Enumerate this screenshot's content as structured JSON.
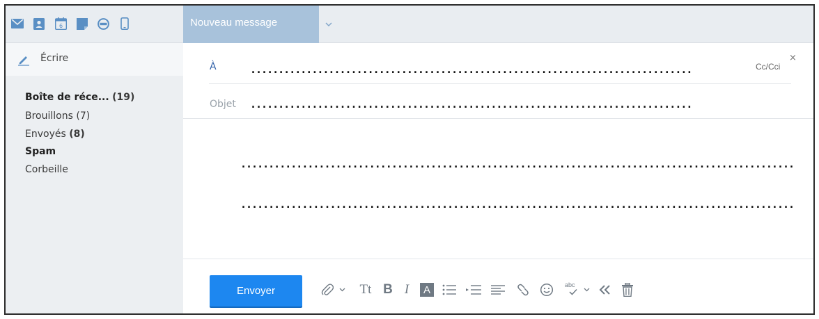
{
  "toolbar": {
    "icons": [
      "mail-icon",
      "contacts-icon",
      "calendar-icon",
      "notes-icon",
      "messenger-icon",
      "mobile-icon"
    ],
    "calendar_day": "6"
  },
  "tab": {
    "label": "Nouveau message"
  },
  "sidebar": {
    "compose_label": "Écrire",
    "folders": [
      {
        "name": "Boîte de réce...",
        "count": "(19)",
        "bold": true
      },
      {
        "name": "Brouillons",
        "count": "(7)",
        "bold": false
      },
      {
        "name": "Envoyés",
        "count": "(8)",
        "bold": false
      },
      {
        "name": "Spam",
        "count": "",
        "bold": true
      },
      {
        "name": "Corbeille",
        "count": "",
        "bold": false
      }
    ]
  },
  "compose": {
    "to_label": "À",
    "to_value": "...............................................................................",
    "cc_label": "Cc/Cci",
    "close_label": "×",
    "subject_label": "Objet",
    "subject_value": "...............................................................................",
    "body_line_1": "...................................................................................................",
    "body_line_2": "..................................................................................................."
  },
  "footer": {
    "send_label": "Envoyer",
    "tools": [
      "attach-icon",
      "attach-menu-icon",
      "font-size-icon",
      "bold-icon",
      "italic-icon",
      "text-color-icon",
      "bullet-list-icon",
      "indent-icon",
      "align-icon",
      "link-icon",
      "emoji-icon",
      "spellcheck-icon",
      "spellcheck-menu-icon",
      "collapse-icon",
      "trash-icon"
    ],
    "font_size_label": "Tt",
    "bold_label": "B",
    "italic_label": "I",
    "text_color_label": "A",
    "spellcheck_label": "abc"
  },
  "colors": {
    "accent": "#1d87f0",
    "tab": "#a8c2db",
    "topbar": "#e9edf1",
    "sidebar": "#eceff2",
    "icon": "#5a8fc4"
  }
}
